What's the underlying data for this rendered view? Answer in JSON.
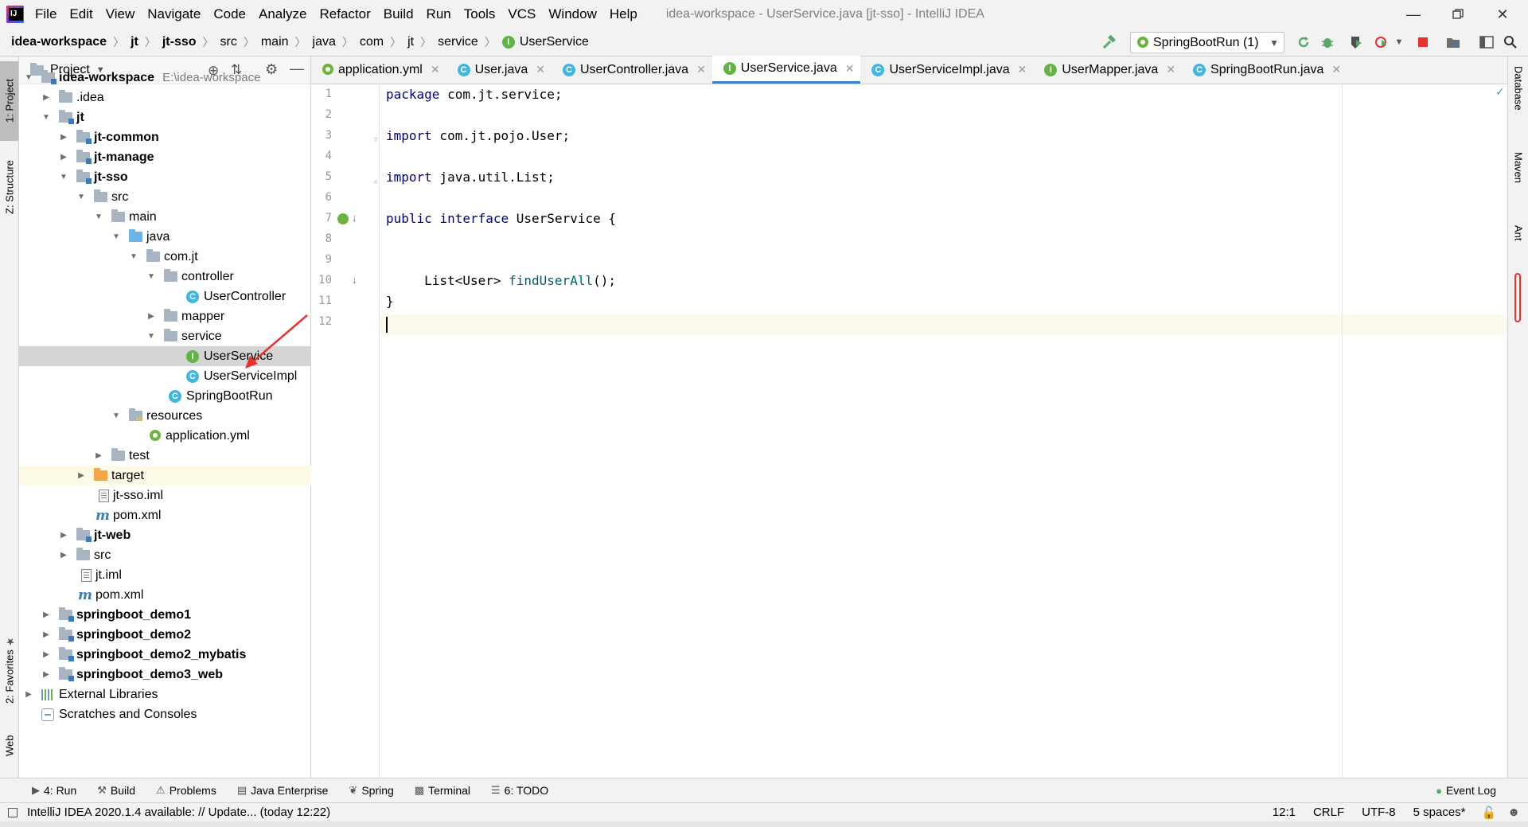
{
  "menubar": {
    "items": [
      "File",
      "Edit",
      "View",
      "Navigate",
      "Code",
      "Analyze",
      "Refactor",
      "Build",
      "Run",
      "Tools",
      "VCS",
      "Window",
      "Help"
    ],
    "title": "idea-workspace - UserService.java [jt-sso] - IntelliJ IDEA"
  },
  "navbar": {
    "crumbs": [
      "idea-workspace",
      "jt",
      "jt-sso",
      "src",
      "main",
      "java",
      "com",
      "jt",
      "service",
      "UserService"
    ],
    "run_config": "SpringBootRun (1)"
  },
  "left_strip": {
    "project": "1: Project",
    "structure": "Z: Structure",
    "favorites": "2: Favorites",
    "web": "Web"
  },
  "right_strip": {
    "database": "Database",
    "maven": "Maven",
    "ant": "Ant"
  },
  "project_panel": {
    "title": "Project",
    "tree": [
      {
        "label": "idea-workspace",
        "path": "E:\\idea-workspace"
      },
      {
        "label": ".idea"
      },
      {
        "label": "jt"
      },
      {
        "label": "jt-common"
      },
      {
        "label": "jt-manage"
      },
      {
        "label": "jt-sso"
      },
      {
        "label": "src"
      },
      {
        "label": "main"
      },
      {
        "label": "java"
      },
      {
        "label": "com.jt"
      },
      {
        "label": "controller"
      },
      {
        "label": "UserController"
      },
      {
        "label": "mapper"
      },
      {
        "label": "service"
      },
      {
        "label": "UserService"
      },
      {
        "label": "UserServiceImpl"
      },
      {
        "label": "SpringBootRun"
      },
      {
        "label": "resources"
      },
      {
        "label": "application.yml"
      },
      {
        "label": "test"
      },
      {
        "label": "target"
      },
      {
        "label": "jt-sso.iml"
      },
      {
        "label": "pom.xml"
      },
      {
        "label": "jt-web"
      },
      {
        "label": "src"
      },
      {
        "label": "jt.iml"
      },
      {
        "label": "pom.xml"
      },
      {
        "label": "springboot_demo1"
      },
      {
        "label": "springboot_demo2"
      },
      {
        "label": "springboot_demo2_mybatis"
      },
      {
        "label": "springboot_demo3_web"
      },
      {
        "label": "External Libraries"
      },
      {
        "label": "Scratches and Consoles"
      }
    ]
  },
  "tabs": [
    "application.yml",
    "User.java",
    "UserController.java",
    "UserService.java",
    "UserServiceImpl.java",
    "UserMapper.java",
    "SpringBootRun.java"
  ],
  "editor": {
    "line_numbers": [
      "1",
      "2",
      "3",
      "4",
      "5",
      "6",
      "7",
      "8",
      "9",
      "10",
      "11",
      "12"
    ],
    "l1_kw": "package",
    "l1_rest": " com.jt.service;",
    "l3_kw": "import",
    "l3_rest": " com.jt.pojo.User;",
    "l5_kw": "import",
    "l5_rest": " java.util.List;",
    "l7_kw1": "public",
    "l7_kw2": "interface",
    "l7_rest": " UserService {",
    "l10_pre": "     List<User> ",
    "l10_fn": "findUserAll",
    "l10_post": "();",
    "l11": "}"
  },
  "toolwindows": [
    "4: Run",
    "Build",
    "Problems",
    "Java Enterprise",
    "Spring",
    "Terminal",
    "6: TODO",
    "Event Log"
  ],
  "status": {
    "message": "IntelliJ IDEA 2020.1.4 available: // Update... (today 12:22)",
    "position": "12:1",
    "line_sep": "CRLF",
    "encoding": "UTF-8",
    "indent": "5 spaces*"
  },
  "colors": {
    "accent": "#4083c9",
    "interface_icon": "#62b543",
    "class_icon": "#40b6e0",
    "selection": "#d5d5d5",
    "arrow": "#e8312f"
  }
}
